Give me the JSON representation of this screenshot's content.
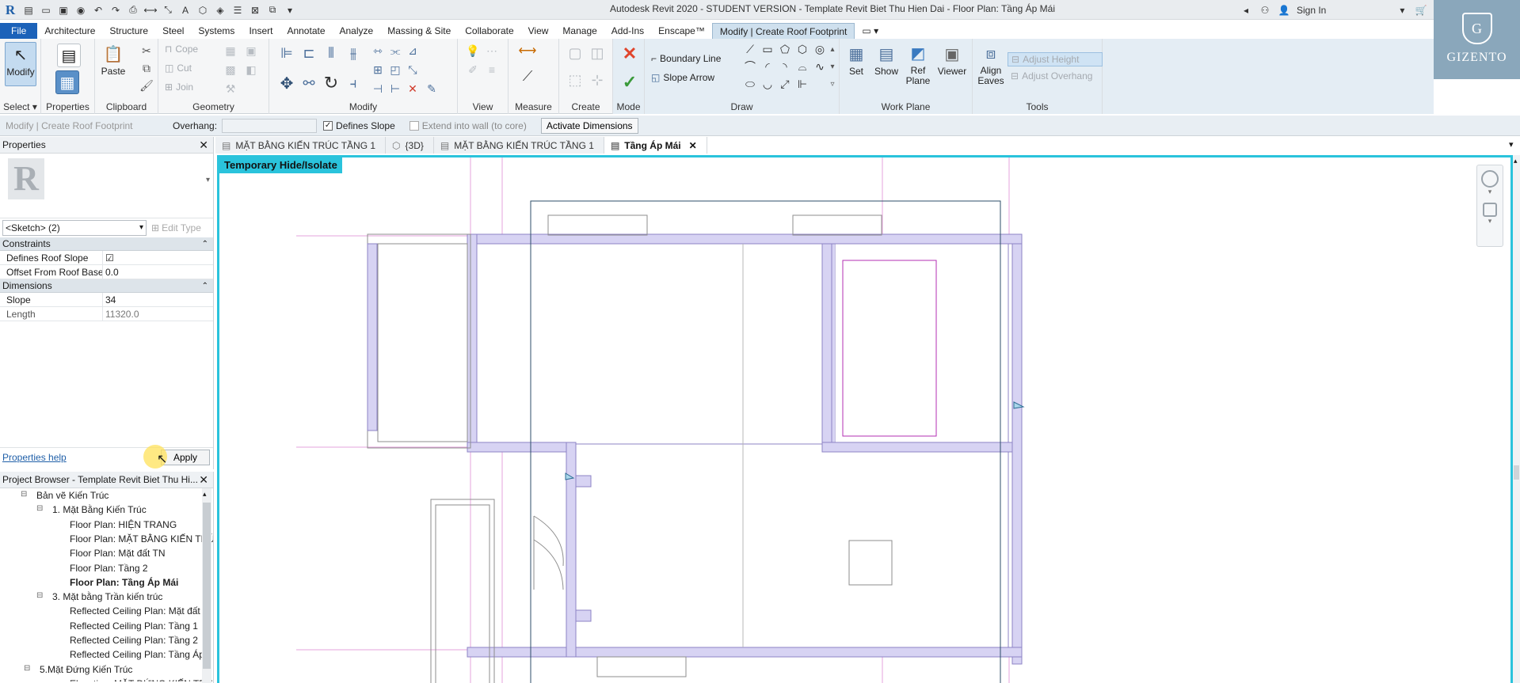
{
  "titlebar": {
    "title": "Autodesk Revit 2020 - STUDENT VERSION - Template Revit Biet Thu Hien Dai - Floor Plan: Tầng Áp Mái",
    "sign_in": "Sign In"
  },
  "brand": {
    "name": "GIZENTO",
    "seal_letter": "G"
  },
  "tabs": [
    "File",
    "Architecture",
    "Structure",
    "Steel",
    "Systems",
    "Insert",
    "Annotate",
    "Analyze",
    "Massing & Site",
    "Collaborate",
    "View",
    "Manage",
    "Add-Ins",
    "Enscape™",
    "Modify | Create Roof Footprint"
  ],
  "ribbon": {
    "select": {
      "modify_label": "Modify",
      "panel": "Select"
    },
    "properties": {
      "panel": "Properties"
    },
    "clipboard": {
      "paste": "Paste",
      "panel": "Clipboard"
    },
    "geometry": {
      "cope": "Cope",
      "cut": "Cut",
      "join": "Join",
      "panel": "Geometry"
    },
    "modify": {
      "panel": "Modify"
    },
    "view": {
      "panel": "View"
    },
    "measure": {
      "panel": "Measure"
    },
    "create": {
      "panel": "Create"
    },
    "mode": {
      "panel": "Mode"
    },
    "draw": {
      "boundary_line": "Boundary Line",
      "slope_arrow": "Slope Arrow",
      "panel": "Draw"
    },
    "work_plane": {
      "set": "Set",
      "show": "Show",
      "ref_plane_1": "Ref",
      "ref_plane_2": "Plane",
      "viewer": "Viewer",
      "panel": "Work Plane"
    },
    "tools": {
      "align_1": "Align",
      "align_2": "Eaves",
      "adjust_height": "Adjust Height",
      "adjust_overhang": "Adjust Overhang",
      "panel": "Tools"
    }
  },
  "options_bar": {
    "context": "Modify | Create Roof Footprint",
    "overhang_label": "Overhang:",
    "overhang_value": "",
    "defines_slope": "Defines Slope",
    "extend": "Extend into wall (to core)",
    "activate_dimensions": "Activate Dimensions"
  },
  "view_tabs": [
    {
      "label": "MẶT BẰNG KIẾN TRÚC TẦNG 1"
    },
    {
      "label": "{3D}"
    },
    {
      "label": "MẶT BẰNG KIẾN TRÚC TẦNG 1"
    },
    {
      "label": "Tầng Áp Mái"
    }
  ],
  "properties": {
    "title": "Properties",
    "type_selector": "<Sketch> (2)",
    "edit_type": "Edit Type",
    "sections": [
      {
        "name": "Constraints",
        "rows": [
          {
            "key": "Defines Roof Slope",
            "value": "☑"
          },
          {
            "key": "Offset From Roof Base",
            "value": "0.0"
          }
        ]
      },
      {
        "name": "Dimensions",
        "rows": [
          {
            "key": "Slope",
            "value": "34"
          },
          {
            "key": "Length",
            "value": "11320.0"
          }
        ]
      }
    ],
    "help": "Properties help",
    "apply": "Apply"
  },
  "project_browser": {
    "title": "Project Browser - Template Revit Biet Thu Hi...",
    "items": [
      {
        "label": "Bản vẽ Kiến Trúc",
        "bold": false
      },
      {
        "label": "1. Mặt Bằng Kiến Trúc",
        "bold": false
      },
      {
        "label": "Floor Plan: HIỆN TRANG",
        "bold": false
      },
      {
        "label": "Floor Plan: MẶT BẰNG KIẾN TRÚ",
        "bold": false
      },
      {
        "label": "Floor Plan: Mặt đất TN",
        "bold": false
      },
      {
        "label": "Floor Plan: Tầng 2",
        "bold": false
      },
      {
        "label": "Floor Plan: Tầng Áp Mái",
        "bold": true
      },
      {
        "label": "3. Mặt bằng Trần kiến trúc",
        "bold": false
      },
      {
        "label": "Reflected Ceiling Plan: Mặt đất",
        "bold": false
      },
      {
        "label": "Reflected Ceiling Plan: Tầng 1",
        "bold": false
      },
      {
        "label": "Reflected Ceiling Plan: Tầng 2",
        "bold": false
      },
      {
        "label": "Reflected Ceiling Plan: Tầng Áp",
        "bold": false
      },
      {
        "label": "5.Mặt Đứng Kiến Trúc",
        "bold": false
      },
      {
        "label": "Elevation: MẶT ĐỨNG KIẾN TRÚ",
        "bold": false
      }
    ]
  },
  "canvas": {
    "banner": "Temporary Hide/Isolate"
  },
  "colors": {
    "accent": "#2ac3dc",
    "file_tab": "#1c62b9",
    "wall_fill": "#d7d3f3",
    "sketch_line": "#b32fb3"
  }
}
